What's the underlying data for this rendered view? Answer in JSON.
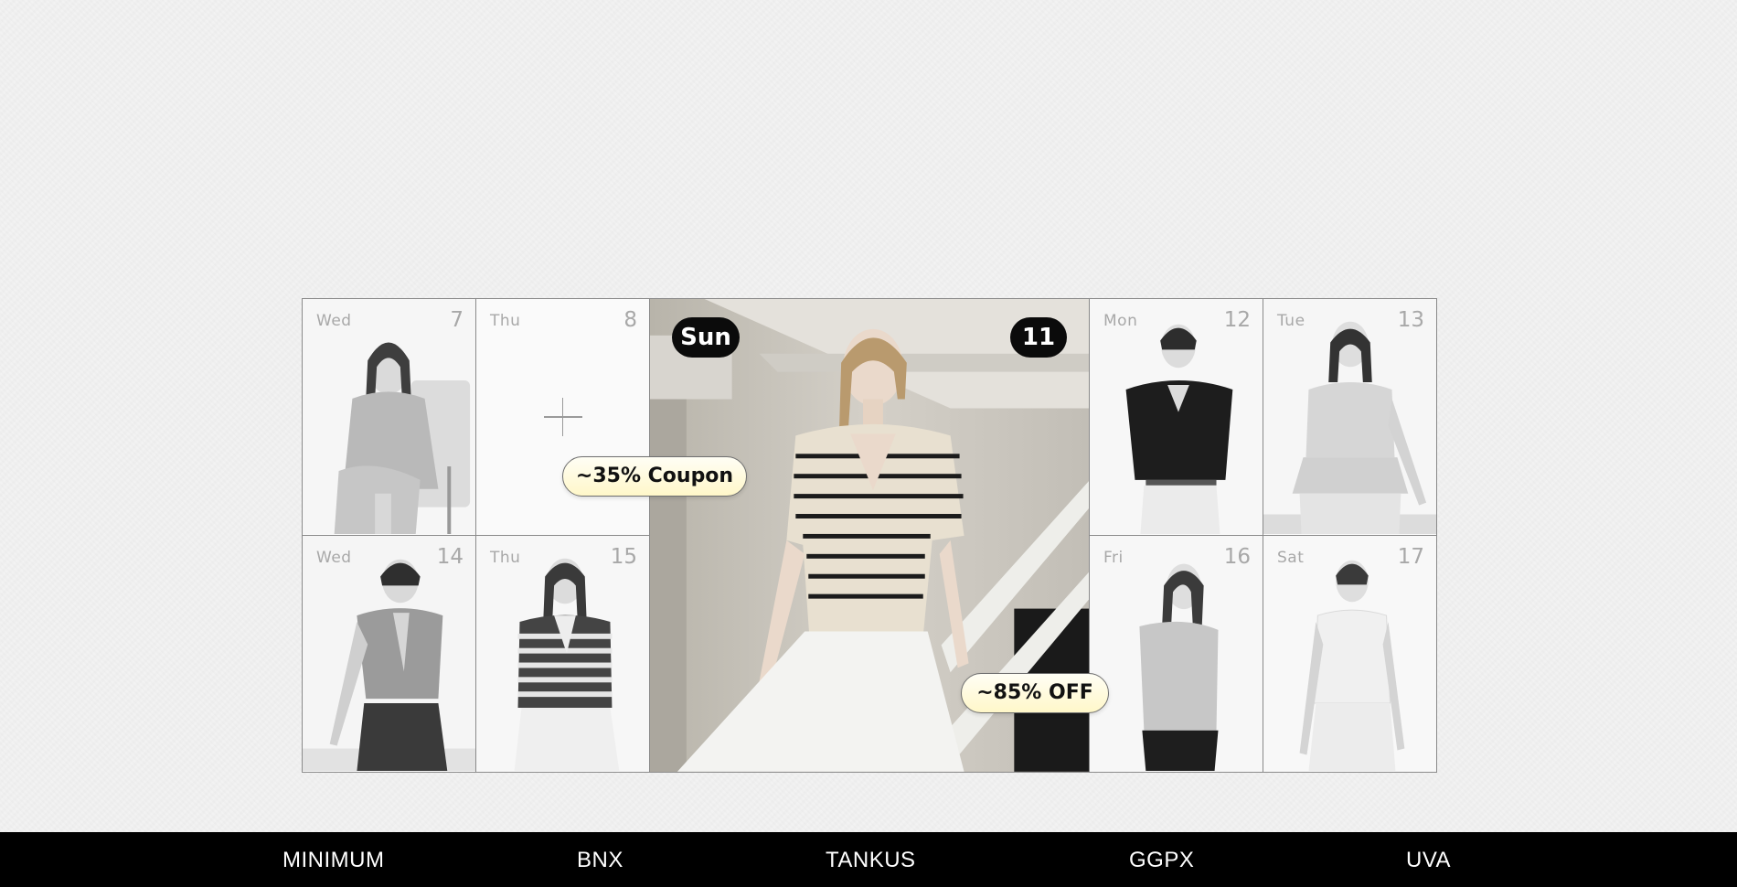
{
  "calendar": {
    "cells": [
      {
        "day": "Wed",
        "num": "7"
      },
      {
        "day": "Thu",
        "num": "8"
      },
      {
        "day": "Wed",
        "num": "14"
      },
      {
        "day": "Thu",
        "num": "15"
      },
      {
        "day": "Mon",
        "num": "12"
      },
      {
        "day": "Tue",
        "num": "13"
      },
      {
        "day": "Fri",
        "num": "16"
      },
      {
        "day": "Sat",
        "num": "17"
      }
    ],
    "feature": {
      "day": "Sun",
      "num": "11"
    }
  },
  "tags": {
    "coupon": "~35% Coupon",
    "off": "~85% OFF"
  },
  "footer": {
    "brands": [
      "MINIMUM",
      "BNX",
      "TANKUS",
      "GGPX",
      "UVA"
    ]
  }
}
